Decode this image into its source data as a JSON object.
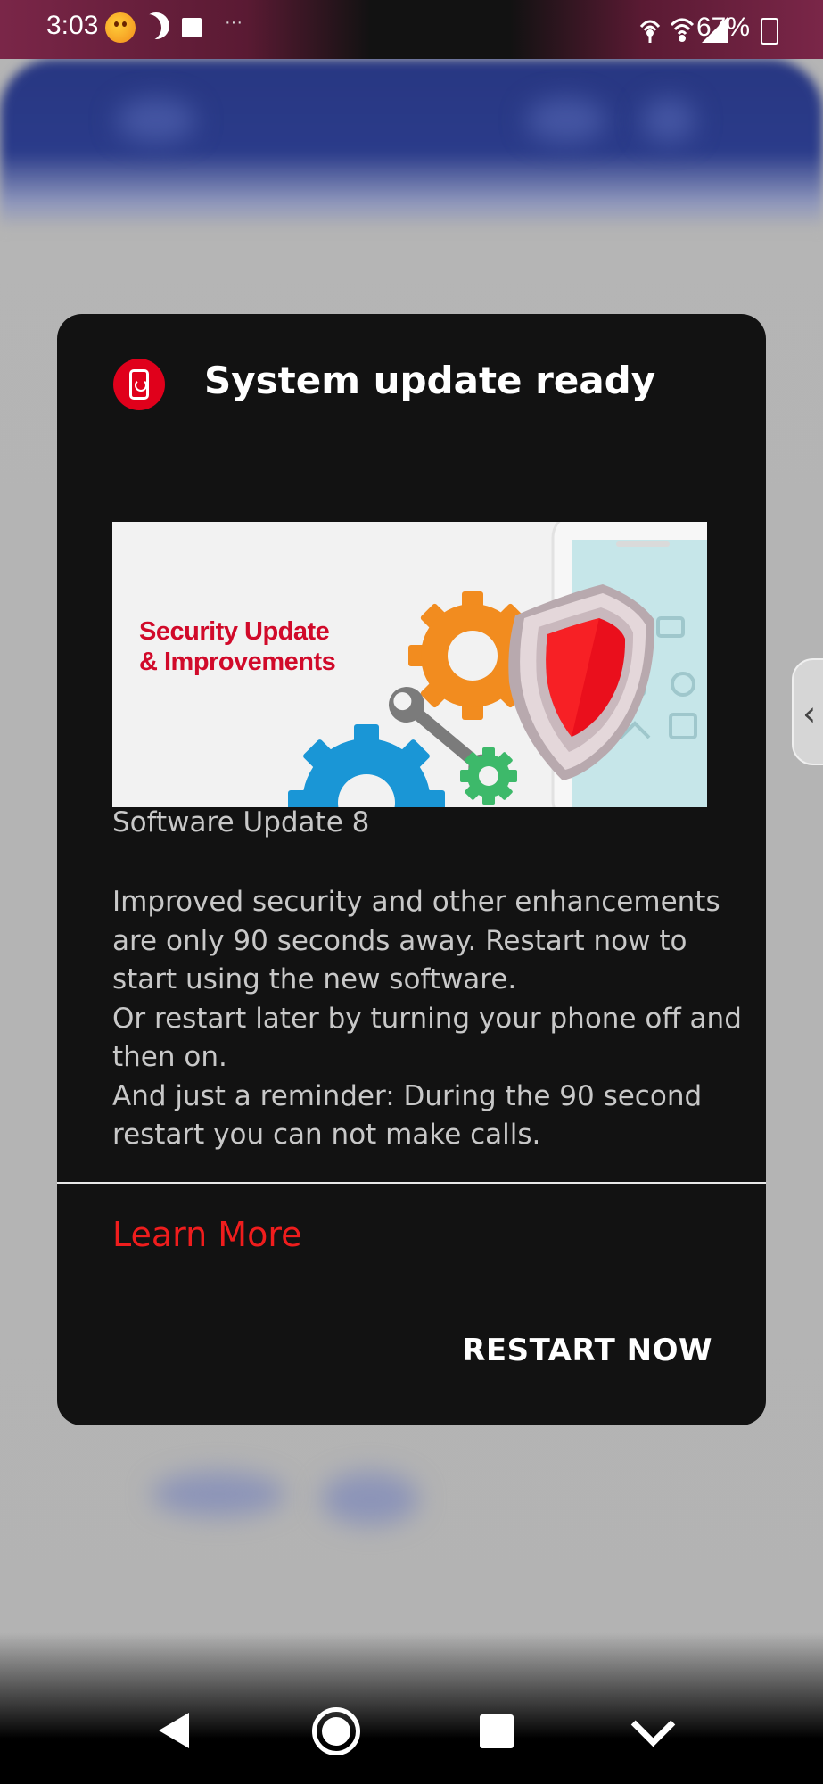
{
  "status_bar": {
    "time": "3:03",
    "dots": "···",
    "battery": "67%",
    "icons": [
      "emoji-icon",
      "moon-icon",
      "square-icon",
      "hotspot-icon",
      "wifi-icon",
      "signal-icon",
      "battery-icon"
    ]
  },
  "dialog": {
    "title": "System update ready",
    "app_icon": "system-update-icon",
    "banner": {
      "line1": "Security Update",
      "line2": "& Improvements"
    },
    "update_name": "Software Update 8",
    "description": [
      "Improved security and other enhancements",
      "are only 90 seconds away. Restart now to",
      "start using the new software.",
      "Or restart later by turning your phone off and",
      "then on.",
      "And just a reminder: During the 90 second",
      "restart you can not make calls."
    ],
    "learn_more": "Learn More",
    "restart_label": "RESTART NOW"
  },
  "side_handle": {
    "icon": "chevron-left-icon",
    "glyph": "‹"
  },
  "nav_bar": {
    "items": [
      "back-icon",
      "home-icon",
      "recents-icon",
      "collapse-icon"
    ]
  },
  "colors": {
    "accent_red": "#e0001b",
    "link_red": "#ef1d1d",
    "dialog_bg": "#121212",
    "header_blue": "#283782"
  }
}
